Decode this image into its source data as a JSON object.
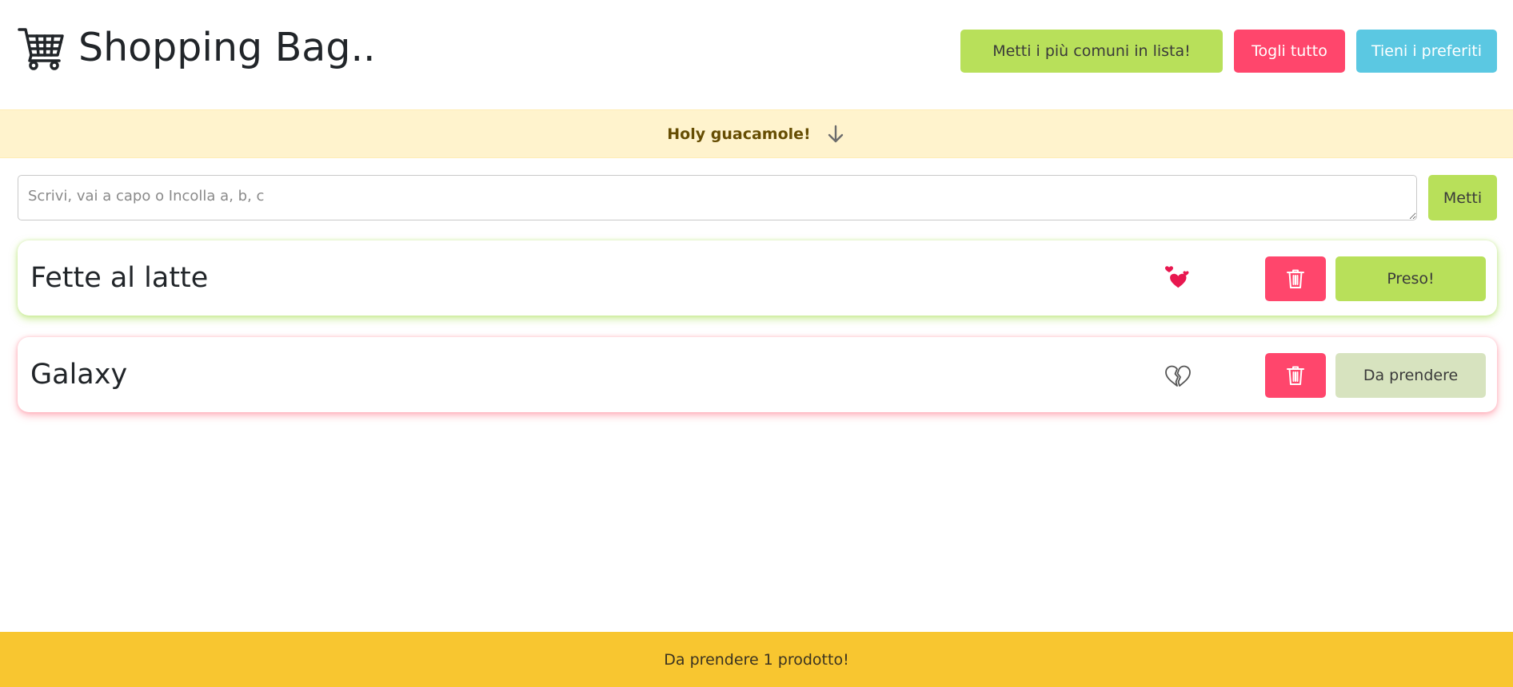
{
  "header": {
    "title": "Shopping Bag..",
    "cart_icon": "shopping-cart-icon",
    "buttons": {
      "common": "Metti i più comuni in lista!",
      "clear": "Togli tutto",
      "favorites": "Tieni i preferiti"
    }
  },
  "alert": {
    "text": "Holy guacamole!",
    "icon": "arrow-down-icon"
  },
  "input": {
    "placeholder": "Scrivi, vai a capo o Incolla a, b, c",
    "value": "",
    "add_label": "Metti"
  },
  "items": [
    {
      "name": "Fette al latte",
      "favorite": true,
      "fav_icon": "hearts-icon",
      "status_label": "Preso!",
      "status": "taken",
      "delete_icon": "trash-icon"
    },
    {
      "name": "Galaxy",
      "favorite": false,
      "fav_icon": "broken-heart-icon",
      "status_label": "Da prendere",
      "status": "pending",
      "delete_icon": "trash-icon"
    }
  ],
  "footer": {
    "text": "Da prendere 1 prodotto!"
  },
  "colors": {
    "green": "#b8e05a",
    "red": "#ff466c",
    "cyan": "#5bc8e2",
    "alert_bg": "#fff3cd",
    "footer_bg": "#f8c630",
    "pending_bg": "#d7e3bf"
  }
}
